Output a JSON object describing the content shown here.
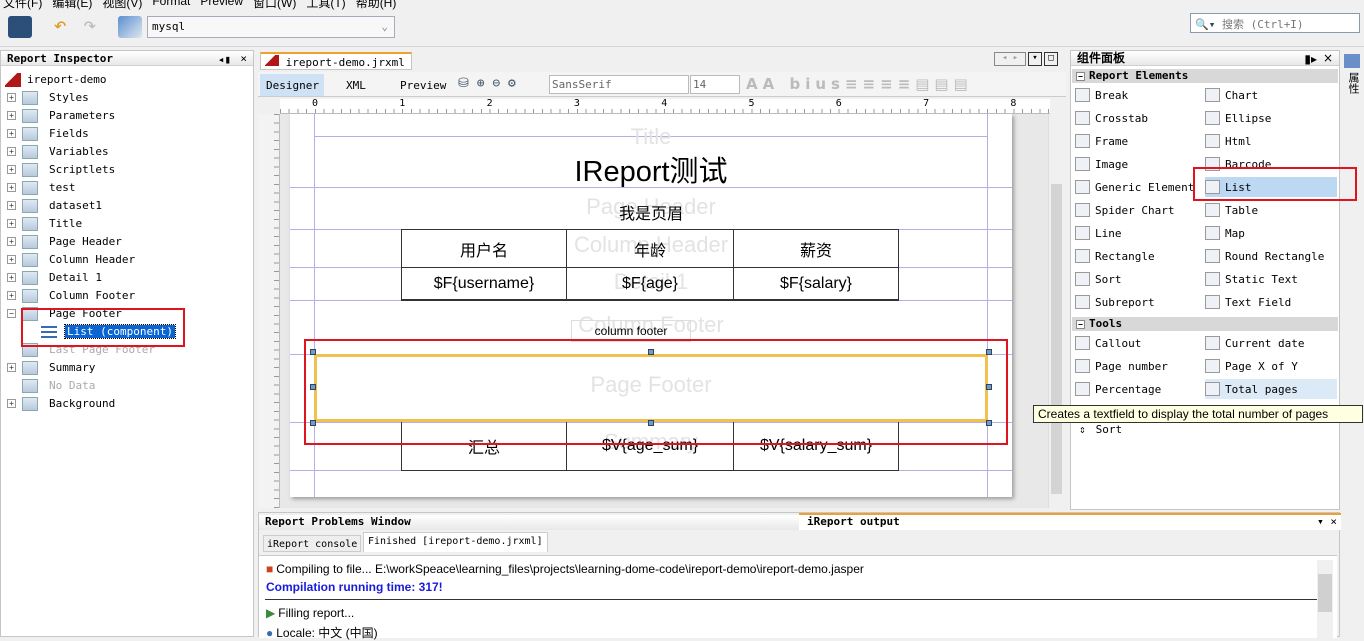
{
  "menu": [
    "文件(F)",
    "编辑(E)",
    "视图(V)",
    "Format",
    "Preview",
    "窗口(W)",
    "工具(T)",
    "帮助(H)"
  ],
  "toolbar": {
    "datasource": "mysql",
    "search_placeholder": "搜索 (Ctrl+I)"
  },
  "inspector": {
    "title": "Report Inspector",
    "root": "ireport-demo",
    "items": [
      {
        "label": "Styles",
        "state": "collapsed"
      },
      {
        "label": "Parameters",
        "state": "collapsed"
      },
      {
        "label": "Fields",
        "state": "collapsed"
      },
      {
        "label": "Variables",
        "state": "collapsed"
      },
      {
        "label": "Scriptlets",
        "state": "collapsed"
      },
      {
        "label": "test",
        "state": "collapsed"
      },
      {
        "label": "dataset1",
        "state": "collapsed"
      },
      {
        "label": "Title",
        "state": "collapsed"
      },
      {
        "label": "Page Header",
        "state": "collapsed"
      },
      {
        "label": "Column Header",
        "state": "collapsed"
      },
      {
        "label": "Detail 1",
        "state": "collapsed"
      },
      {
        "label": "Column Footer",
        "state": "collapsed"
      },
      {
        "label": "Page Footer",
        "state": "expanded"
      },
      {
        "label": "List (component)",
        "state": "selected"
      },
      {
        "label": "Last Page Footer",
        "state": "disabled"
      },
      {
        "label": "Summary",
        "state": "collapsed"
      },
      {
        "label": "No Data",
        "state": "disabled"
      },
      {
        "label": "Background",
        "state": "collapsed"
      }
    ]
  },
  "editor": {
    "file_tab": "ireport-demo.jrxml",
    "views": [
      "Designer",
      "XML",
      "Preview"
    ],
    "active_view": "Designer",
    "font": "SansSerif",
    "font_size": "14",
    "ruler": [
      "0",
      "1",
      "2",
      "3",
      "4",
      "5",
      "6",
      "7",
      "8"
    ],
    "bands": {
      "title": "Title",
      "page_header": "Page Header",
      "column_header": "Column Header",
      "detail": "Detail 1",
      "column_footer": "Column Footer",
      "page_footer": "Page Footer",
      "summary": "Summary"
    },
    "report_title": "IReport测试",
    "page_header_text": "我是页眉",
    "column_headers": [
      "用户名",
      "年龄",
      "薪资"
    ],
    "detail_fields": [
      "$F{username}",
      "$F{age}",
      "$F{salary}"
    ],
    "column_footer_text": "column footer",
    "summary_cells": [
      "汇总",
      "$V{age_sum}",
      "$V{salary_sum}"
    ]
  },
  "palette": {
    "title": "组件面板",
    "side_tab": "属性",
    "groups": [
      {
        "name": "Report Elements",
        "items": [
          "Break",
          "Chart",
          "Crosstab",
          "Ellipse",
          "Frame",
          "Html",
          "Image",
          "Barcode",
          "Generic Element",
          "List",
          "Spider Chart",
          "Table",
          "Line",
          "Map",
          "Rectangle",
          "Round Rectangle",
          "Sort",
          "Static Text",
          "Subreport",
          "Text Field"
        ]
      },
      {
        "name": "Tools",
        "items": [
          "Callout",
          "Current date",
          "Page number",
          "Page X of Y",
          "Percentage",
          "Total pages"
        ]
      }
    ],
    "selected": "List",
    "hovered": "Total pages",
    "tooltip": "Creates a textfield to display the total number of pages",
    "below_tooltip": "Sort"
  },
  "output": {
    "tabs": [
      "Report Problems Window",
      "iReport output"
    ],
    "active_tab": "iReport output",
    "subtabs": [
      "iReport console",
      "Finished [ireport-demo.jrxml]"
    ],
    "lines": [
      "Compiling to file... E:\\workSpeace\\learning_files\\projects\\learning-dome-code\\ireport-demo\\ireport-demo.jasper",
      "Compilation running time: 317!",
      "Filling report...",
      "Locale: 中文 (中国)"
    ],
    "highlight_color": "#1a1adc"
  }
}
